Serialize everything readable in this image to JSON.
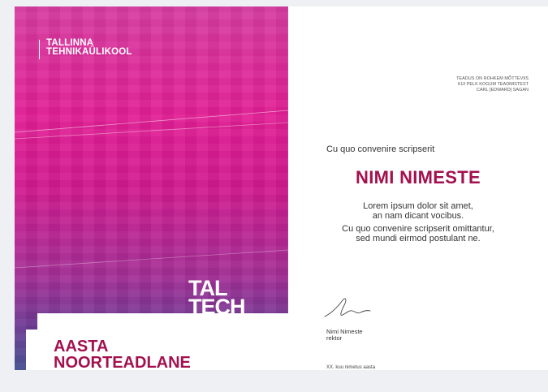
{
  "university": {
    "line1": "TALLINNA",
    "line2": "TEHNIKAÜLIKOOL"
  },
  "brand": {
    "line1": "TAL",
    "line2": "TECH"
  },
  "award": {
    "line1": "AASTA",
    "line2": "NOORTEADLANE"
  },
  "quote": {
    "line1": "TEADUS ON ROHKEM MÕTTEVIIS",
    "line2": "KUI PELK KOGUM TEADMISTEST",
    "author": "CARL [EDWARD] SAGAN"
  },
  "lead_line": "Cu quo convenire scripserit",
  "recipient": "NIMI NIMESTE",
  "body": {
    "p1_line1": "Lorem ipsum dolor sit amet,",
    "p1_line2": "an nam dicant vocibus.",
    "p2_line1": "Cu quo convenire scripserit omittantur,",
    "p2_line2": "sed mundi eirmod postulant ne."
  },
  "signer": {
    "name": "Nimi Nimeste",
    "title": "rektor"
  },
  "date_line": "XX. kuu nimetus aasta",
  "colors": {
    "brand_magenta": "#e21e95",
    "accent_dark_red": "#a3114f",
    "gradient_bottom": "#3f4a8c"
  },
  "icons": {
    "signature": "handwritten-signature"
  }
}
